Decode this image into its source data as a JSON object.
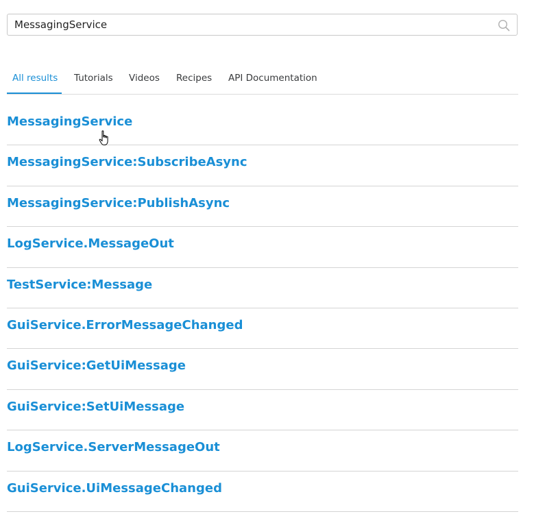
{
  "search": {
    "value": "MessagingService",
    "placeholder": ""
  },
  "tabs": [
    {
      "label": "All results",
      "active": true
    },
    {
      "label": "Tutorials",
      "active": false
    },
    {
      "label": "Videos",
      "active": false
    },
    {
      "label": "Recipes",
      "active": false
    },
    {
      "label": "API Documentation",
      "active": false
    }
  ],
  "results": [
    {
      "title": "MessagingService"
    },
    {
      "title": "MessagingService:SubscribeAsync"
    },
    {
      "title": "MessagingService:PublishAsync"
    },
    {
      "title": "LogService.MessageOut"
    },
    {
      "title": "TestService:Message"
    },
    {
      "title": "GuiService.ErrorMessageChanged"
    },
    {
      "title": "GuiService:GetUiMessage"
    },
    {
      "title": "GuiService:SetUiMessage"
    },
    {
      "title": "LogService.ServerMessageOut"
    },
    {
      "title": "GuiService.UiMessageChanged"
    }
  ],
  "colors": {
    "accent": "#1a8fd6",
    "text": "#393b3d",
    "divider": "#d4d4d4"
  },
  "icons": {
    "search": "search-icon",
    "cursor": "hand-pointer-icon"
  }
}
